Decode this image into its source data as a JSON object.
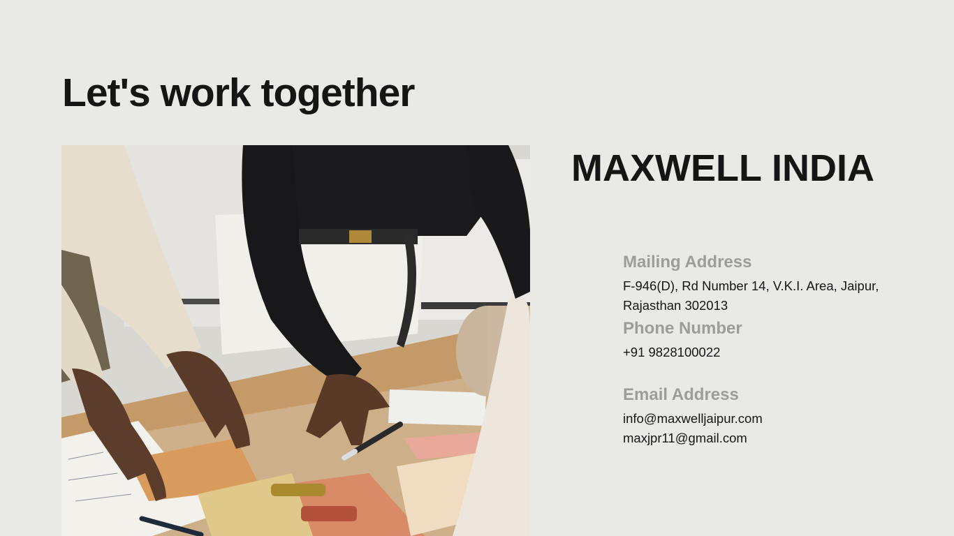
{
  "page": {
    "heading": "Let's work together",
    "company": "MAXWELL INDIA"
  },
  "contact": {
    "mailing": {
      "label": "Mailing Address",
      "line1": "F-946(D), Rd Number 14, V.K.I. Area, Jaipur,",
      "line2": "Rajasthan 302013"
    },
    "phone": {
      "label": "Phone Number",
      "value": "+91 9828100022"
    },
    "email": {
      "label": "Email Address",
      "primary": "info@maxwelljaipur.com",
      "secondary": "maxjpr11@gmail.com"
    }
  },
  "colors": {
    "background": "#e9eae6",
    "text": "#151515",
    "label": "#9c9c9a"
  }
}
